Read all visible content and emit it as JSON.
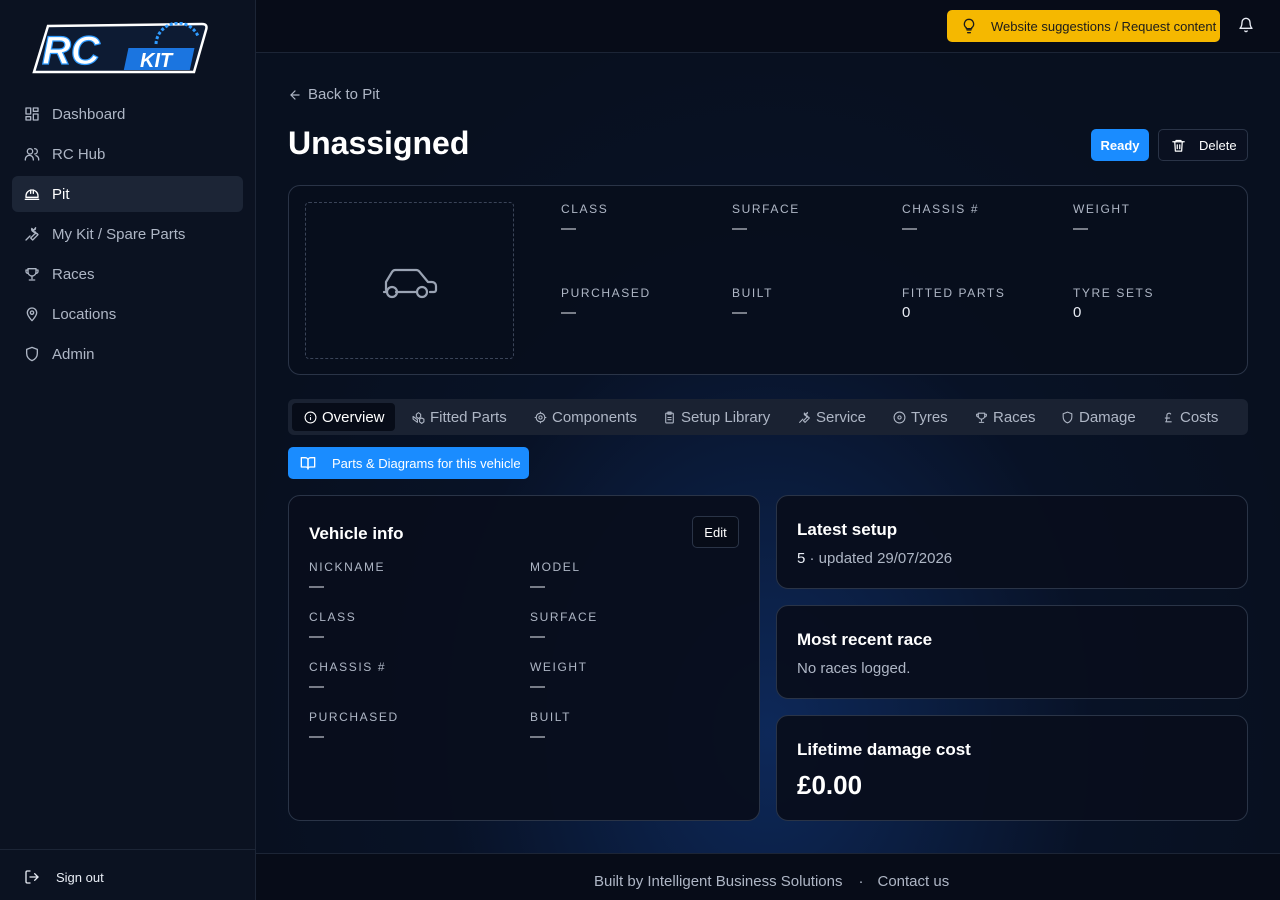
{
  "brand": {
    "logo_main": "RC",
    "logo_sub": "KIT"
  },
  "sidebar": {
    "items": [
      {
        "label": "Dashboard",
        "icon": "dashboard-icon"
      },
      {
        "label": "RC Hub",
        "icon": "users-icon"
      },
      {
        "label": "Pit",
        "icon": "helmet-icon"
      },
      {
        "label": "My Kit / Spare Parts",
        "icon": "wrench-icon"
      },
      {
        "label": "Races",
        "icon": "trophy-icon"
      },
      {
        "label": "Locations",
        "icon": "map-pin-icon"
      },
      {
        "label": "Admin",
        "icon": "shield-icon"
      }
    ],
    "active_index": 2,
    "sign_out": "Sign out"
  },
  "topbar": {
    "suggest_label": "Website suggestions / Request content",
    "suggest_color": "#f5b800"
  },
  "header": {
    "back_label": "Back to Pit",
    "title": "Unassigned",
    "ready_label": "Ready",
    "delete_label": "Delete"
  },
  "summary": {
    "class_label": "CLASS",
    "class_value": "—",
    "surface_label": "SURFACE",
    "surface_value": "—",
    "chassis_label": "CHASSIS #",
    "chassis_value": "—",
    "weight_label": "WEIGHT",
    "weight_value": "—",
    "purchased_label": "PURCHASED",
    "purchased_value": "—",
    "built_label": "BUILT",
    "built_value": "—",
    "fitted_label": "FITTED PARTS",
    "fitted_value": "0",
    "tyres_label": "TYRE SETS",
    "tyres_value": "0"
  },
  "tabs": [
    {
      "label": "Overview",
      "icon": "info-icon"
    },
    {
      "label": "Fitted Parts",
      "icon": "parts-icon"
    },
    {
      "label": "Components",
      "icon": "cog-icon"
    },
    {
      "label": "Setup Library",
      "icon": "clipboard-icon"
    },
    {
      "label": "Service",
      "icon": "wrench-icon"
    },
    {
      "label": "Tyres",
      "icon": "tyre-icon"
    },
    {
      "label": "Races",
      "icon": "trophy-icon"
    },
    {
      "label": "Damage",
      "icon": "shield-icon"
    },
    {
      "label": "Costs",
      "icon": "pound-icon"
    }
  ],
  "parts_button": "Parts & Diagrams for this vehicle",
  "vehicle_info": {
    "title": "Vehicle info",
    "edit_label": "Edit",
    "nickname_label": "NICKNAME",
    "nickname_value": "—",
    "model_label": "MODEL",
    "model_value": "—",
    "class_label": "CLASS",
    "class_value": "—",
    "surface_label": "SURFACE",
    "surface_value": "—",
    "chassis_label": "CHASSIS #",
    "chassis_value": "—",
    "weight_label": "WEIGHT",
    "weight_value": "—",
    "purchased_label": "PURCHASED",
    "purchased_value": "—",
    "built_label": "BUILT",
    "built_value": "—"
  },
  "latest_setup": {
    "title": "Latest setup",
    "count": "5",
    "updated": " · updated 29/07/2026"
  },
  "recent_race": {
    "title": "Most recent race",
    "text": "No races logged."
  },
  "damage_cost": {
    "title": "Lifetime damage cost",
    "value": "£0.00"
  },
  "footer": {
    "built_by": "Built by Intelligent Business Solutions",
    "separator": "·",
    "contact": "Contact us"
  },
  "colors": {
    "accent": "#1a8cff",
    "warning": "#f5b800",
    "background": "#08101f"
  }
}
